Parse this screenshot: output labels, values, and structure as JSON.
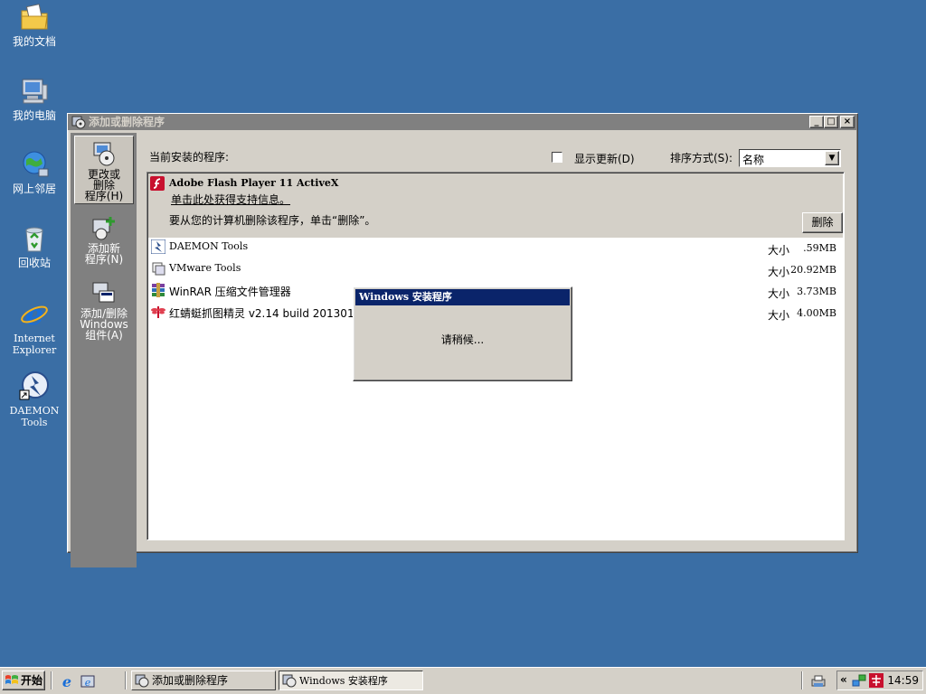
{
  "desktop": {
    "icons": [
      {
        "label": "我的文档",
        "icon": "folder-documents-icon"
      },
      {
        "label": "我的电脑",
        "icon": "computer-icon"
      },
      {
        "label": "网上邻居",
        "icon": "network-icon"
      },
      {
        "label": "回收站",
        "icon": "recycle-bin-icon"
      },
      {
        "label": "Internet Explorer",
        "icon": "internet-explorer-icon"
      },
      {
        "label": "DAEMON Tools",
        "icon": "daemon-tools-icon"
      }
    ]
  },
  "arp_window": {
    "title": "添加或删除程序",
    "controls": {
      "minimize": "_",
      "maximize": "□",
      "close": "×"
    },
    "sidebar": [
      {
        "label": "更改或删除程序(H)",
        "lines": [
          "更改或",
          "删除",
          "程序(H)"
        ],
        "selected": true
      },
      {
        "label": "添加新程序(N)",
        "lines": [
          "添加新",
          "程序(N)"
        ],
        "selected": false
      },
      {
        "label": "添加/删除 Windows 组件(A)",
        "lines": [
          "添加/删除",
          "Windows",
          "组件(A)"
        ],
        "selected": false
      }
    ],
    "header": {
      "installed_label": "当前安装的程序:",
      "show_updates_label": "显示更新(D)",
      "show_updates_checked": false,
      "sort_label": "排序方式(S):",
      "sort_value": "名称"
    },
    "selected_program": {
      "name": "Adobe Flash Player 11 ActiveX",
      "support_link": "单击此处获得支持信息。",
      "remove_hint": "要从您的计算机删除该程序，单击“删除”。",
      "remove_button": "删除"
    },
    "programs": [
      {
        "name": "DAEMON Tools",
        "size_label": "大小",
        "size": ".59MB",
        "icon": "daemon-tools-icon"
      },
      {
        "name": "VMware Tools",
        "size_label": "大小",
        "size": "20.92MB",
        "icon": "vmware-icon"
      },
      {
        "name": "WinRAR 压缩文件管理器",
        "size_label": "大小",
        "size": "3.73MB",
        "icon": "winrar-icon"
      },
      {
        "name": "红蜻蜓抓图精灵 v2.14 build 2013010",
        "size_label": "大小",
        "size": "4.00MB",
        "icon": "dragonfly-icon"
      }
    ]
  },
  "installer_dialog": {
    "title": "Windows 安装程序",
    "message": "请稍候..."
  },
  "taskbar": {
    "start_label": "开始",
    "quick_launch": [
      "internet-explorer-icon",
      "show-desktop-icon"
    ],
    "tasks": [
      {
        "label": "添加或删除程序",
        "pressed": false
      },
      {
        "label": "Windows 安装程序",
        "pressed": true
      }
    ],
    "clock": "14:59",
    "tray_chevron": "«"
  }
}
